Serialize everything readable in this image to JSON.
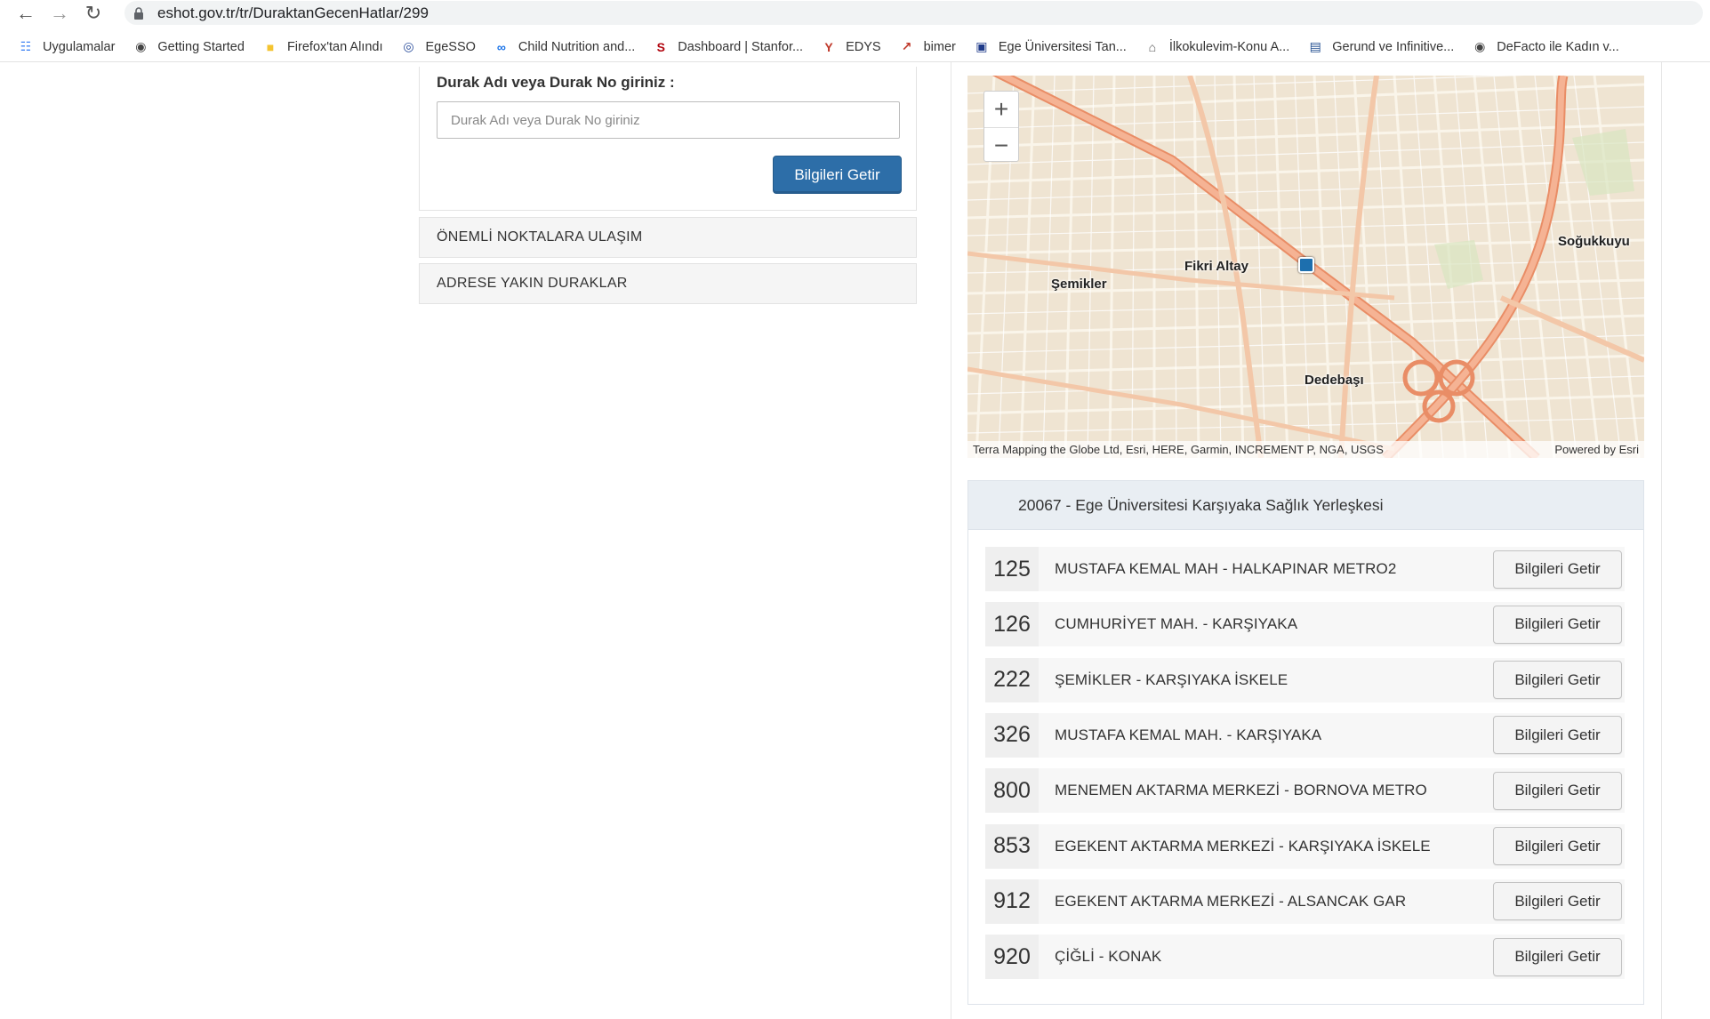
{
  "browser": {
    "url": "eshot.gov.tr/tr/DuraktanGecenHatlar/299",
    "bookmarks": [
      {
        "label": "Uygulamalar",
        "icon": "apps-grid-icon",
        "color": "#4285f4"
      },
      {
        "label": "Getting Started",
        "icon": "globe-icon",
        "color": "#444444"
      },
      {
        "label": "Firefox'tan Alındı",
        "icon": "folder-icon",
        "color": "#f4c430"
      },
      {
        "label": "EgeSSO",
        "icon": "egesso-icon",
        "color": "#2a4d9b"
      },
      {
        "label": "Child Nutrition and...",
        "icon": "infinity-icon",
        "color": "#1a73e8"
      },
      {
        "label": "Dashboard | Stanfor...",
        "icon": "stanford-icon",
        "color": "#b1040e"
      },
      {
        "label": "EDYS",
        "icon": "edys-icon",
        "color": "#c0392b"
      },
      {
        "label": "bimer",
        "icon": "bimer-icon",
        "color": "#c0392b"
      },
      {
        "label": "Ege Üniversitesi Tan...",
        "icon": "ege-logo-icon",
        "color": "#1f3b8a"
      },
      {
        "label": "İlkokulevim-Konu A...",
        "icon": "ilkokul-icon",
        "color": "#555555"
      },
      {
        "label": "Gerund ve Infinitive...",
        "icon": "gerund-icon",
        "color": "#1e4b8f"
      },
      {
        "label": "DeFacto ile Kadın v...",
        "icon": "globe-icon",
        "color": "#444444"
      }
    ]
  },
  "search": {
    "label": "Durak Adı veya Durak No giriniz :",
    "placeholder": "Durak Adı veya Durak No giriniz",
    "button": "Bilgileri Getir"
  },
  "accordions": [
    "ÖNEMLİ NOKTALARA ULAŞIM",
    "ADRESE YAKIN DURAKLAR"
  ],
  "map": {
    "places": [
      "Fikri Altay",
      "Şemikler",
      "Dedebaşı",
      "Soğukkuyu"
    ],
    "attribution_left": "Terra Mapping the Globe Ltd, Esri, HERE, Garmin, INCREMENT P, NGA, USGS",
    "attribution_right": "Powered by Esri",
    "zoom_in": "+",
    "zoom_out": "−"
  },
  "stop": {
    "title": "20067 - Ege Üniversitesi Karşıyaka Sağlık Yerleşkesi",
    "button_label": "Bilgileri Getir",
    "lines": [
      {
        "no": "125",
        "name": "MUSTAFA KEMAL MAH - HALKAPINAR METRO2"
      },
      {
        "no": "126",
        "name": "CUMHURİYET MAH. - KARŞIYAKA"
      },
      {
        "no": "222",
        "name": "ŞEMİKLER - KARŞIYAKA İSKELE"
      },
      {
        "no": "326",
        "name": "MUSTAFA KEMAL MAH. - KARŞIYAKA"
      },
      {
        "no": "800",
        "name": "MENEMEN AKTARMA MERKEZİ - BORNOVA METRO"
      },
      {
        "no": "853",
        "name": "EGEKENT AKTARMA MERKEZİ - KARŞIYAKA İSKELE"
      },
      {
        "no": "912",
        "name": "EGEKENT AKTARMA MERKEZİ - ALSANCAK GAR"
      },
      {
        "no": "920",
        "name": "ÇİĞLİ - KONAK"
      }
    ]
  },
  "colors": {
    "primary_button": "#2d6ea8",
    "panel_header": "#e9eef3",
    "map_land": "#efe4d2",
    "map_highway": "#f0a17a"
  }
}
